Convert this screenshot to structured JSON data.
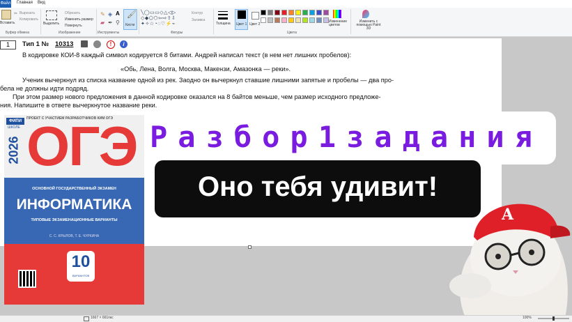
{
  "ribbon": {
    "tabs": [
      "Файл",
      "Главная",
      "Вид"
    ],
    "clipboard": {
      "paste": "Вставить",
      "cut": "Вырезать",
      "copy": "Копировать",
      "label": "Буфер обмена"
    },
    "image": {
      "select": "Выделить",
      "crop": "Обрезать",
      "resize": "Изменить размер",
      "rotate": "Повернуть",
      "label": "Изображение"
    },
    "tools": {
      "label": "Инструменты",
      "brushes": "Кисти"
    },
    "shapes": {
      "outline": "Контур",
      "fill": "Заливка",
      "label": "Фигуры"
    },
    "size": "Толщина",
    "color1": "Цвет 1",
    "color2": "Цвет 2",
    "colors_label": "Цвета",
    "edit_colors": "Изменение цветов",
    "paint3d": "Изменить с помощью Paint 3D",
    "palette": [
      "#000000",
      "#7f7f7f",
      "#880015",
      "#ed1c24",
      "#ff7f27",
      "#fff200",
      "#22b14c",
      "#00a2e8",
      "#3f48cc",
      "#a349a4",
      "#ffffff",
      "#c3c3c3",
      "#b97a57",
      "#ffaec9",
      "#ffc90e",
      "#efe4b0",
      "#b5e61d",
      "#99d9ea",
      "#7092be",
      "#c8bfe7"
    ]
  },
  "task": {
    "number_box": "1",
    "type": "Тип 1 №",
    "id": "10313",
    "line1": "В кодировке КОИ-8 каждый символ кодируется 8 битами. Андрей написал текст (в нем нет лишних пробелов):",
    "line2": "«Обь, Лена, Волга, Москва, Макензи, Амазонка — реки».",
    "line3": "Ученик вычеркнул из списка название одной из рек. Заодно он вычеркнул ставшие лишними запятые и пробелы — два про-",
    "line4": "бела не должны идти подряд.",
    "line5": "При этом размер нового предложения в данной кодировке оказался на 8 байтов меньше, чем размер исходного предложе-",
    "line6": "ния. Напишите в ответе вычеркнутое название реки."
  },
  "overlay": {
    "title": "Разбор1задания",
    "subtitle": "Оно тебя удивит!"
  },
  "book": {
    "header": "ПРОЕКТ С УЧАСТИЕМ РАЗРАБОТЧИКОВ КИМ ОГЭ",
    "badge": "ФИПИ",
    "school": "ШКОЛЕ",
    "year": "2026",
    "big": "ОГЭ",
    "exam": "ОСНОВНОЙ ГОСУДАРСТВЕННЫЙ ЭКЗАМЕН",
    "subject": "ИНФОРМАТИКА",
    "variants": "ТИПОВЫЕ ЭКЗАМЕНАЦИОННЫЕ ВАРИАНТЫ",
    "authors": "С. С. КРЫЛОВ, Т. Е. ЧУРКИНА",
    "count": "10",
    "count_label": "ВАРИАНТОВ"
  },
  "status": {
    "size": "1667 × 661пкс",
    "zoom": "100%"
  }
}
